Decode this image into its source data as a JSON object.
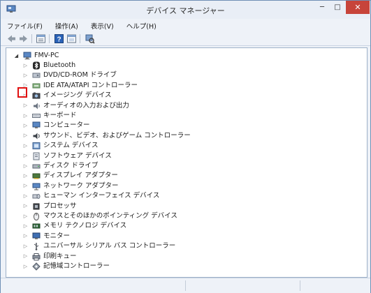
{
  "window": {
    "title": "デバイス マネージャー",
    "controls": {
      "minimize": "─",
      "maximize": "□",
      "close": "✕"
    }
  },
  "menu": [
    "ファイル(F)",
    "操作(A)",
    "表示(V)",
    "ヘルプ(H)"
  ],
  "toolbar": [
    {
      "name": "back-icon"
    },
    {
      "name": "forward-icon"
    },
    {
      "name": "properties-icon"
    },
    {
      "name": "help-icon"
    },
    {
      "name": "details-view-icon"
    },
    {
      "name": "scan-hardware-icon"
    }
  ],
  "tree": {
    "root": {
      "label": "FMV-PC",
      "icon": "computer-icon",
      "expanded": true
    },
    "items": [
      {
        "label": "Bluetooth",
        "icon": "bluetooth-icon"
      },
      {
        "label": "DVD/CD-ROM ドライブ",
        "icon": "dvd-drive-icon"
      },
      {
        "label": "IDE ATA/ATAPI コントローラー",
        "icon": "ide-controller-icon"
      },
      {
        "label": "イメージング デバイス",
        "icon": "imaging-device-icon"
      },
      {
        "label": "オーディオの入力および出力",
        "icon": "audio-icon"
      },
      {
        "label": "キーボード",
        "icon": "keyboard-icon"
      },
      {
        "label": "コンピューター",
        "icon": "computer-icon"
      },
      {
        "label": "サウンド、ビデオ、およびゲーム コントローラー",
        "icon": "sound-icon"
      },
      {
        "label": "システム デバイス",
        "icon": "system-device-icon"
      },
      {
        "label": "ソフトウェア デバイス",
        "icon": "software-device-icon"
      },
      {
        "label": "ディスク ドライブ",
        "icon": "disk-drive-icon"
      },
      {
        "label": "ディスプレイ アダプター",
        "icon": "display-adapter-icon"
      },
      {
        "label": "ネットワーク アダプター",
        "icon": "network-adapter-icon"
      },
      {
        "label": "ヒューマン インターフェイス デバイス",
        "icon": "hid-icon"
      },
      {
        "label": "プロセッサ",
        "icon": "processor-icon"
      },
      {
        "label": "マウスとそのほかのポインティング デバイス",
        "icon": "mouse-icon"
      },
      {
        "label": "メモリ テクノロジ デバイス",
        "icon": "memory-icon"
      },
      {
        "label": "モニター",
        "icon": "monitor-icon"
      },
      {
        "label": "ユニバーサル シリアル バス コントローラー",
        "icon": "usb-icon"
      },
      {
        "label": "印刷キュー",
        "icon": "printer-icon"
      },
      {
        "label": "記憶域コントローラー",
        "icon": "storage-controller-icon"
      }
    ]
  },
  "colors": {
    "highlight": "#e01010",
    "titlebar": "#e9eef6",
    "close": "#c7443a"
  }
}
